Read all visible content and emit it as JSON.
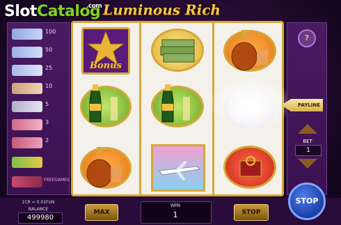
{
  "header": {
    "logo_slot": "Slot",
    "logo_catalog": "Catalog",
    "logo_com": ".com",
    "game_title": "Luminous Rich"
  },
  "paytable": [
    {
      "value": "100",
      "color": "#8fa8e0"
    },
    {
      "value": "50",
      "color": "#9ab0e6"
    },
    {
      "value": "25",
      "color": "#a6b8ea"
    },
    {
      "value": "10",
      "color": "#c9a07a"
    },
    {
      "value": "5",
      "color": "#b0b0c8"
    },
    {
      "value": "3",
      "color": "#d06a8a"
    },
    {
      "value": "2",
      "color": "#c85a7a"
    },
    {
      "value": "",
      "color": "#7fc04a"
    },
    {
      "value": "FREEGAMES",
      "color": "#c84a6a"
    }
  ],
  "reels": {
    "bonus_text": "Bonus",
    "colors": {
      "gold": "#d6a73a",
      "purple": "#5a1a7a",
      "green": "#8ccf3a",
      "orange": "#e67a1a",
      "red": "#d23a2a"
    }
  },
  "right_panel": {
    "help": "?",
    "payline": "PAYLINE",
    "bet_label": "BET",
    "bet_value": "1"
  },
  "bottom": {
    "cr_info": "1CR = 0.01FUN",
    "balance_label": "BALANCE",
    "balance_value": "499980",
    "max_label": "MAX",
    "win_label": "WIN",
    "win_value": "1",
    "stop_label": "STOP",
    "stop_big_label": "STOP"
  }
}
